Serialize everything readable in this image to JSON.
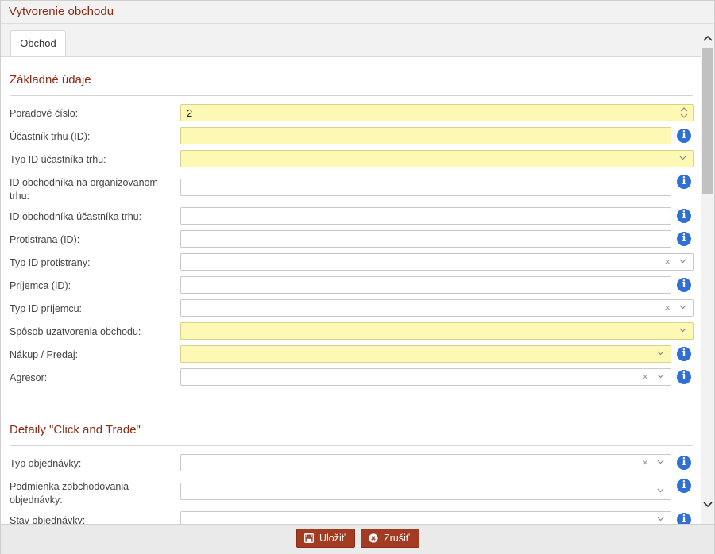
{
  "window": {
    "title": "Vytvorenie obchodu"
  },
  "tabs": [
    {
      "label": "Obchod"
    }
  ],
  "sections": {
    "basic": {
      "title": "Základné údaje"
    },
    "click_trade": {
      "title": "Detaily \"Click and Trade\""
    }
  },
  "fields": {
    "poradove_cislo": {
      "label": "Poradové číslo:",
      "value": "2"
    },
    "ucastnik_trhu": {
      "label": "Účastník trhu (ID):",
      "value": ""
    },
    "typ_id_ucastnika": {
      "label": "Typ ID účastníka trhu:",
      "value": ""
    },
    "id_obchodnika_org": {
      "label": "ID obchodníka na organizovanom trhu:",
      "value": ""
    },
    "id_obchodnika_ucastnika": {
      "label": "ID obchodníka účastníka trhu:",
      "value": ""
    },
    "protistrana": {
      "label": "Protistrana (ID):",
      "value": ""
    },
    "typ_id_protistrany": {
      "label": "Typ ID protistrany:",
      "value": ""
    },
    "prijemca": {
      "label": "Príjemca (ID):",
      "value": ""
    },
    "typ_id_prijemcu": {
      "label": "Typ ID príjemcu:",
      "value": ""
    },
    "sposob_uzatvorenia": {
      "label": "Spôsob uzatvorenia obchodu:",
      "value": ""
    },
    "nakup_predaj": {
      "label": "Nákup / Predaj:",
      "value": ""
    },
    "agresor": {
      "label": "Agresor:",
      "value": ""
    },
    "typ_objednavky": {
      "label": "Typ objednávky:",
      "value": ""
    },
    "podmienka_zobchodovania": {
      "label": "Podmienka zobchodovania objednávky:",
      "value": ""
    },
    "stav_objednavky": {
      "label": "Stav objednávky:",
      "value": ""
    }
  },
  "icons": {
    "info": "info-circle-icon",
    "clear": "clear-x-icon",
    "dropdown": "chevron-down-icon",
    "spinner": "spinner-arrows-icon",
    "save": "floppy-disk-icon",
    "cancel": "close-circle-icon",
    "info_glyph": "i",
    "clear_glyph": "×"
  },
  "footer": {
    "save_label": "Uložiť",
    "cancel_label": "Zrušiť"
  },
  "colors": {
    "accent": "#8c2a14",
    "button": "#a33a22",
    "required_bg": "#fdf8b4",
    "info_icon": "#2f6fd6"
  }
}
